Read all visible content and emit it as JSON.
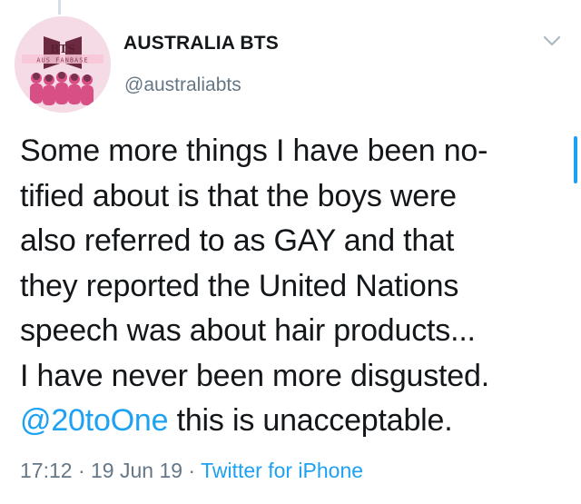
{
  "tweet": {
    "author": {
      "name": "AUSTRALIA BTS",
      "handle": "@australiabts",
      "avatar_text": {
        "logo": "BTS",
        "banner": "AUS FANBASE"
      }
    },
    "body_lines": [
      "Some more things I have been no-",
      "tified about is that the boys were",
      "also referred to as GAY and that",
      "they reported the United Nations",
      "speech was about hair products...",
      "I have never been more disgusted."
    ],
    "last_line": {
      "mention": "@20toOne",
      "text": " this is unacceptable."
    },
    "meta": {
      "time": "17:12",
      "separator": " · ",
      "date": "19 Jun 19",
      "source": "Twitter for iPhone"
    }
  },
  "colors": {
    "link": "#1da1f2",
    "text": "#14171a",
    "secondary": "#657786"
  },
  "icons": {
    "menu": "chevron-down-icon"
  }
}
